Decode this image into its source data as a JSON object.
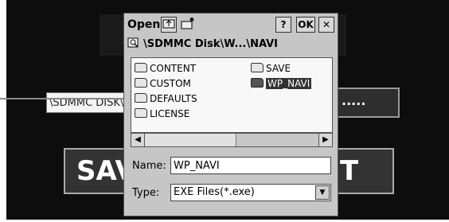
{
  "background": {
    "path_text": "\\SDMMC DISK\\",
    "right_button": ".....",
    "save_button": "SAV",
    "exit_button": "T"
  },
  "dialog": {
    "title": "Open",
    "up_folder_icon": "up-folder-icon",
    "new_folder_icon": "new-folder-icon",
    "help_label": "?",
    "ok_label": "OK",
    "close_label": "✕",
    "path": "\\SDMMC Disk\\W...\\NAVI",
    "items": [
      {
        "label": "CONTENT"
      },
      {
        "label": "CUSTOM"
      },
      {
        "label": "DEFAULTS"
      },
      {
        "label": "LICENSE"
      },
      {
        "label": "SAVE"
      },
      {
        "label": "WP_NAVI"
      }
    ],
    "name_label": "Name:",
    "name_value": "WP_NAVI",
    "type_label": "Type:",
    "type_value": "EXE Files(*.exe)"
  }
}
